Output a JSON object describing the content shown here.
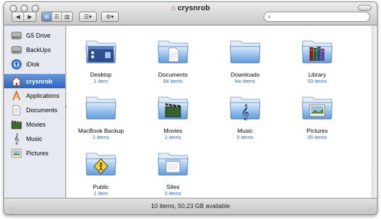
{
  "window": {
    "title": "crysnrob"
  },
  "toolbar": {
    "back_glyph": "◀",
    "forward_glyph": "▶",
    "view_icon": "⊞",
    "view_list": "☰",
    "view_columns": "▥",
    "arrange_glyph": "☰▾",
    "action_glyph": "⚙▾",
    "search_placeholder": ""
  },
  "sidebar": {
    "items": [
      {
        "label": "G5 Drive",
        "icon": "hard-drive-icon"
      },
      {
        "label": "BackUps",
        "icon": "hard-drive-icon"
      },
      {
        "label": "iDisk",
        "icon": "idisk-icon"
      },
      {
        "label": "crysnrob",
        "icon": "home-icon",
        "selected": true
      },
      {
        "label": "Applications",
        "icon": "applications-icon"
      },
      {
        "label": "Documents",
        "icon": "documents-icon"
      },
      {
        "label": "Movies",
        "icon": "movies-icon"
      },
      {
        "label": "Music",
        "icon": "music-icon"
      },
      {
        "label": "Pictures",
        "icon": "pictures-icon"
      }
    ]
  },
  "items": [
    {
      "name": "Desktop",
      "count": "1 item",
      "icon": "desktop-folder-icon"
    },
    {
      "name": "Documents",
      "count": "64 items",
      "icon": "documents-folder-icon"
    },
    {
      "name": "Downloads",
      "count": "No items",
      "icon": "downloads-folder-icon"
    },
    {
      "name": "Library",
      "count": "53 items",
      "icon": "library-folder-icon"
    },
    {
      "name": "MacBook Backup",
      "count": "2 items",
      "icon": "folder-icon"
    },
    {
      "name": "Movies",
      "count": "2 items",
      "icon": "movies-folder-icon"
    },
    {
      "name": "Music",
      "count": "5 items",
      "icon": "music-folder-icon"
    },
    {
      "name": "Pictures",
      "count": "55 items",
      "icon": "pictures-folder-icon"
    },
    {
      "name": "Public",
      "count": "1 item",
      "icon": "public-folder-icon"
    },
    {
      "name": "Sites",
      "count": "2 items",
      "icon": "sites-folder-icon"
    }
  ],
  "status": {
    "text": "10 items, 50.23 GB available"
  },
  "colors": {
    "selection": "#2a63c0",
    "folder_light": "#cfe3f7",
    "folder_dark": "#5f9fe0"
  }
}
